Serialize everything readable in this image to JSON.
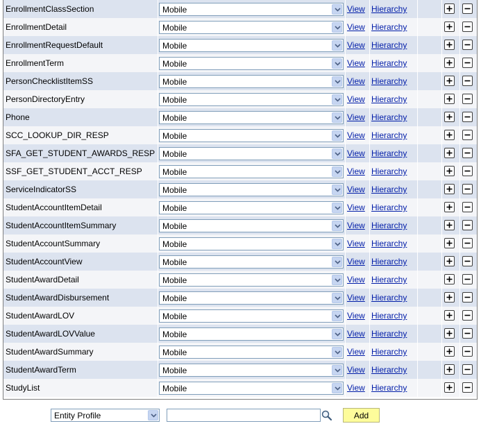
{
  "rows": [
    {
      "name": "EnrollmentClassSection",
      "profile": "Mobile"
    },
    {
      "name": "EnrollmentDetail",
      "profile": "Mobile"
    },
    {
      "name": "EnrollmentRequestDefault",
      "profile": "Mobile"
    },
    {
      "name": "EnrollmentTerm",
      "profile": "Mobile"
    },
    {
      "name": "PersonChecklistItemSS",
      "profile": "Mobile"
    },
    {
      "name": "PersonDirectoryEntry",
      "profile": "Mobile"
    },
    {
      "name": "Phone",
      "profile": "Mobile"
    },
    {
      "name": "SCC_LOOKUP_DIR_RESP",
      "profile": "Mobile"
    },
    {
      "name": "SFA_GET_STUDENT_AWARDS_RESP",
      "profile": "Mobile"
    },
    {
      "name": "SSF_GET_STUDENT_ACCT_RESP",
      "profile": "Mobile"
    },
    {
      "name": "ServiceIndicatorSS",
      "profile": "Mobile"
    },
    {
      "name": "StudentAccountItemDetail",
      "profile": "Mobile"
    },
    {
      "name": "StudentAccountItemSummary",
      "profile": "Mobile"
    },
    {
      "name": "StudentAccountSummary",
      "profile": "Mobile"
    },
    {
      "name": "StudentAccountView",
      "profile": "Mobile"
    },
    {
      "name": "StudentAwardDetail",
      "profile": "Mobile"
    },
    {
      "name": "StudentAwardDisbursement",
      "profile": "Mobile"
    },
    {
      "name": "StudentAwardLOV",
      "profile": "Mobile"
    },
    {
      "name": "StudentAwardLOVValue",
      "profile": "Mobile"
    },
    {
      "name": "StudentAwardSummary",
      "profile": "Mobile"
    },
    {
      "name": "StudentAwardTerm",
      "profile": "Mobile"
    },
    {
      "name": "StudyList",
      "profile": "Mobile"
    }
  ],
  "links": {
    "view": "View",
    "hierarchy": "Hierarchy"
  },
  "icons": {
    "dropdown": "chevron-down-icon",
    "add_row": "plus-icon",
    "delete_row": "minus-icon",
    "search": "magnifier-icon"
  },
  "bottom": {
    "type_select": "Entity Profile",
    "search_value": "",
    "add_label": "Add"
  },
  "colors": {
    "row_odd": "#dce3ef",
    "row_even": "#f4f5f8",
    "link": "#001ca8",
    "add_button": "#fdfc9b"
  }
}
